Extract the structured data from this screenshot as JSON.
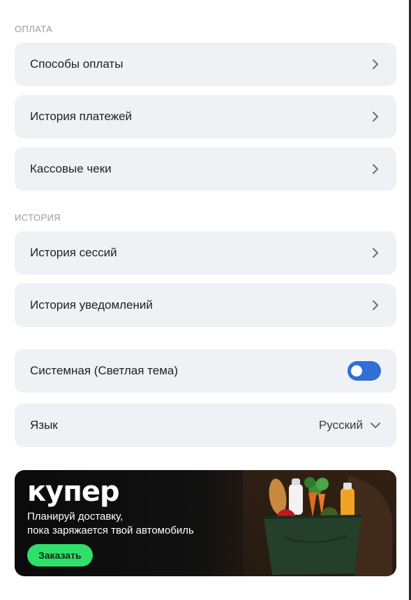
{
  "sections": {
    "payment": {
      "title": "ОПЛАТА",
      "items": [
        {
          "label": "Способы оплаты"
        },
        {
          "label": "История платежей"
        },
        {
          "label": "Кассовые чеки"
        }
      ]
    },
    "history": {
      "title": "ИСТОРИЯ",
      "items": [
        {
          "label": "История сессий"
        },
        {
          "label": "История уведомлений"
        }
      ]
    }
  },
  "theme": {
    "label": "Системная (Светлая тема)",
    "toggle_state": "on"
  },
  "language": {
    "label": "Язык",
    "value": "Русский"
  },
  "promo": {
    "logo": "купер",
    "line1": "Планируй доставку,",
    "line2": "пока заряжается твой автомобиль",
    "button": "Заказать"
  },
  "colors": {
    "row_bg": "#f0f1f5",
    "toggle_on": "#2f6fd6",
    "promo_button": "#2ee06a",
    "section_label": "#9a9aa3"
  },
  "icons": {
    "row_arrow": "chevron-right-icon",
    "dropdown": "chevron-down-icon"
  }
}
